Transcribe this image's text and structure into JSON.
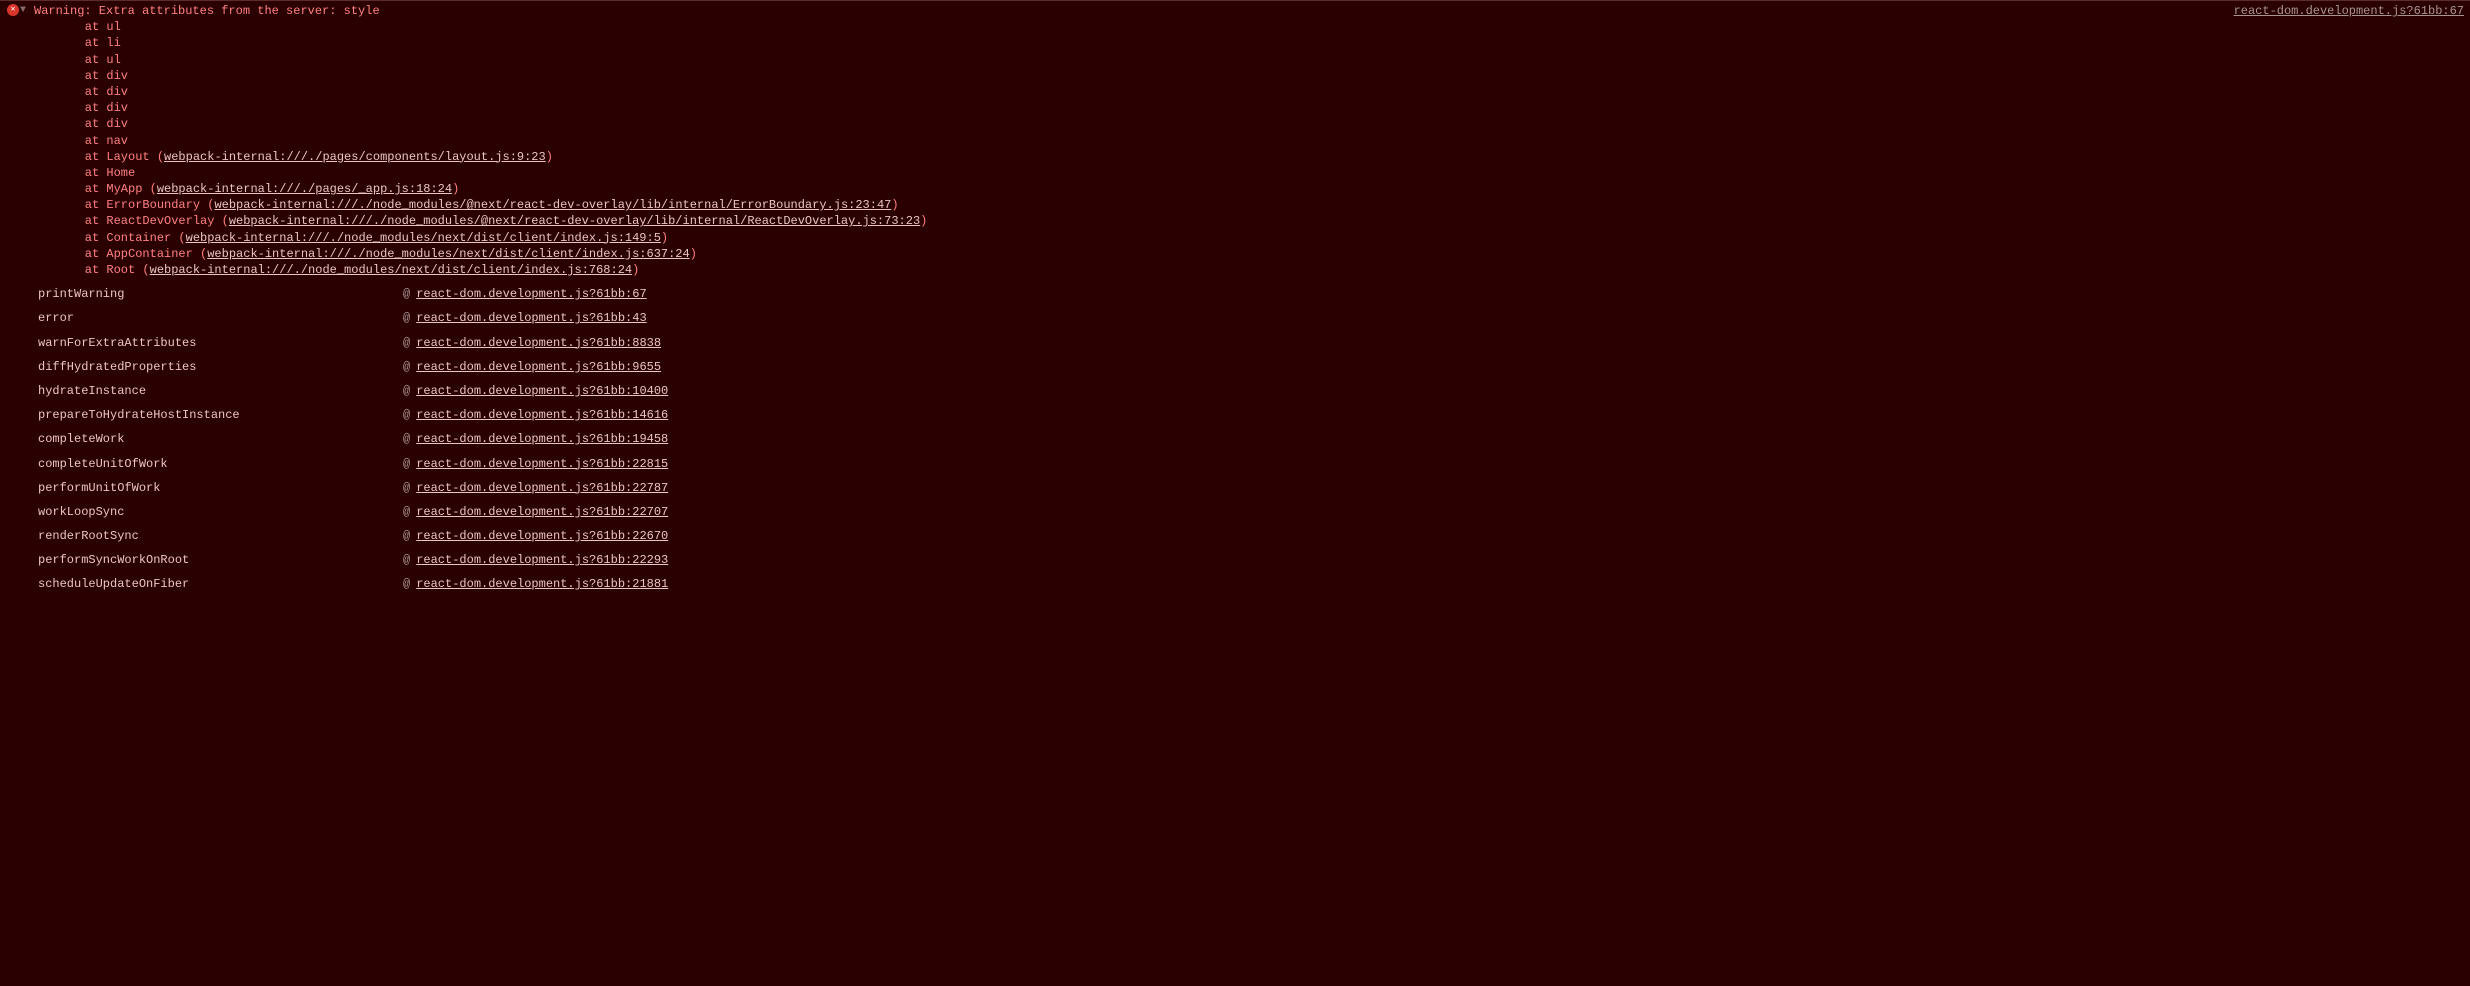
{
  "message": {
    "label": "Warning:",
    "text": " Extra attributes from the server: style",
    "sourceLink": "react-dom.development.js?61bb:67"
  },
  "stack": [
    {
      "prefix": "    at ul",
      "link": null,
      "suffix": ""
    },
    {
      "prefix": "    at li",
      "link": null,
      "suffix": ""
    },
    {
      "prefix": "    at ul",
      "link": null,
      "suffix": ""
    },
    {
      "prefix": "    at div",
      "link": null,
      "suffix": ""
    },
    {
      "prefix": "    at div",
      "link": null,
      "suffix": ""
    },
    {
      "prefix": "    at div",
      "link": null,
      "suffix": ""
    },
    {
      "prefix": "    at div",
      "link": null,
      "suffix": ""
    },
    {
      "prefix": "    at nav",
      "link": null,
      "suffix": ""
    },
    {
      "prefix": "    at Layout (",
      "link": "webpack-internal:///./pages/components/layout.js:9:23",
      "suffix": ")"
    },
    {
      "prefix": "    at Home",
      "link": null,
      "suffix": ""
    },
    {
      "prefix": "    at MyApp (",
      "link": "webpack-internal:///./pages/_app.js:18:24",
      "suffix": ")"
    },
    {
      "prefix": "    at ErrorBoundary (",
      "link": "webpack-internal:///./node_modules/@next/react-dev-overlay/lib/internal/ErrorBoundary.js:23:47",
      "suffix": ")"
    },
    {
      "prefix": "    at ReactDevOverlay (",
      "link": "webpack-internal:///./node_modules/@next/react-dev-overlay/lib/internal/ReactDevOverlay.js:73:23",
      "suffix": ")"
    },
    {
      "prefix": "    at Container (",
      "link": "webpack-internal:///./node_modules/next/dist/client/index.js:149:5",
      "suffix": ")"
    },
    {
      "prefix": "    at AppContainer (",
      "link": "webpack-internal:///./node_modules/next/dist/client/index.js:637:24",
      "suffix": ")"
    },
    {
      "prefix": "    at Root (",
      "link": "webpack-internal:///./node_modules/next/dist/client/index.js:768:24",
      "suffix": ")"
    }
  ],
  "calls": [
    {
      "fn": "printWarning",
      "at": "@",
      "link": "react-dom.development.js?61bb:67"
    },
    {
      "fn": "error",
      "at": "@",
      "link": "react-dom.development.js?61bb:43"
    },
    {
      "fn": "warnForExtraAttributes",
      "at": "@",
      "link": "react-dom.development.js?61bb:8838"
    },
    {
      "fn": "diffHydratedProperties",
      "at": "@",
      "link": "react-dom.development.js?61bb:9655"
    },
    {
      "fn": "hydrateInstance",
      "at": "@",
      "link": "react-dom.development.js?61bb:10400"
    },
    {
      "fn": "prepareToHydrateHostInstance",
      "at": "@",
      "link": "react-dom.development.js?61bb:14616"
    },
    {
      "fn": "completeWork",
      "at": "@",
      "link": "react-dom.development.js?61bb:19458"
    },
    {
      "fn": "completeUnitOfWork",
      "at": "@",
      "link": "react-dom.development.js?61bb:22815"
    },
    {
      "fn": "performUnitOfWork",
      "at": "@",
      "link": "react-dom.development.js?61bb:22787"
    },
    {
      "fn": "workLoopSync",
      "at": "@",
      "link": "react-dom.development.js?61bb:22707"
    },
    {
      "fn": "renderRootSync",
      "at": "@",
      "link": "react-dom.development.js?61bb:22670"
    },
    {
      "fn": "performSyncWorkOnRoot",
      "at": "@",
      "link": "react-dom.development.js?61bb:22293"
    },
    {
      "fn": "scheduleUpdateOnFiber",
      "at": "@",
      "link": "react-dom.development.js?61bb:21881"
    }
  ]
}
